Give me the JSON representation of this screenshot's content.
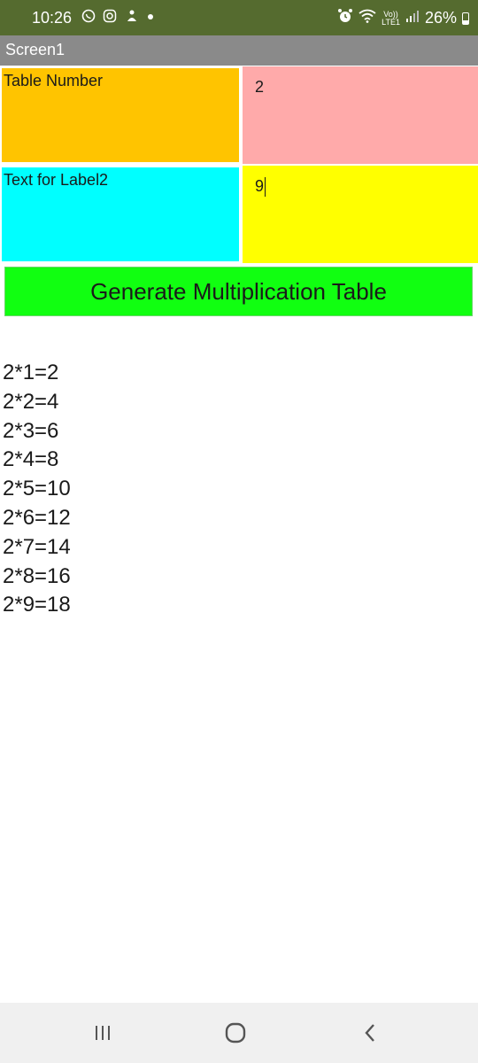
{
  "status_bar": {
    "time": "10:26",
    "left_icons": [
      "whatsapp-icon",
      "instagram-icon",
      "notification-icon",
      "dot-icon"
    ],
    "network_label_top": "Vo))",
    "network_label_bottom": "LTE1",
    "battery": "26%"
  },
  "app": {
    "title": "Screen1"
  },
  "grid": {
    "label1": "Table Number",
    "input1_value": "2",
    "label2": "Text for Label2",
    "input2_value": "9",
    "colors": {
      "orange": "#ffc400",
      "pink": "#ffaaaa",
      "cyan": "#00ffff",
      "yellow": "#ffff00"
    }
  },
  "button": {
    "label": "Generate Multiplication Table",
    "color": "#11ff11"
  },
  "results": [
    "2*1=2",
    "2*2=4",
    "2*3=6",
    "2*4=8",
    "2*5=10",
    "2*6=12",
    "2*7=14",
    "2*8=16",
    "2*9=18"
  ],
  "nav": {
    "icons": [
      "recent-apps-icon",
      "home-icon",
      "back-icon"
    ]
  }
}
